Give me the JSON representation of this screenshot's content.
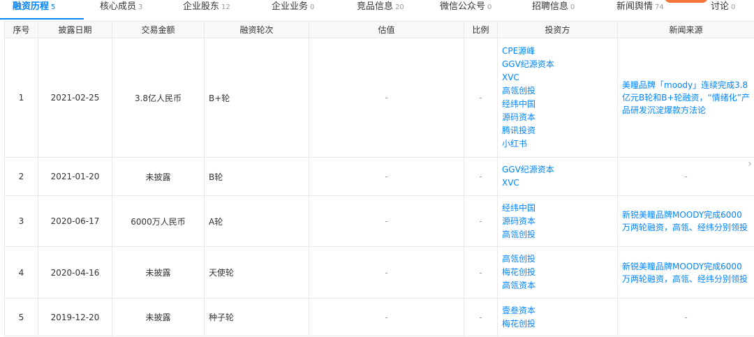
{
  "tabs": [
    {
      "label": "融资历程",
      "count": "5",
      "active": true
    },
    {
      "label": "核心成员",
      "count": "3"
    },
    {
      "label": "企业股东",
      "count": "12"
    },
    {
      "label": "企业业务",
      "count": "0"
    },
    {
      "label": "竞品信息",
      "count": "20"
    },
    {
      "label": "微信公众号",
      "count": "0"
    },
    {
      "label": "招聘信息",
      "count": "0"
    },
    {
      "label": "新闻舆情",
      "count": "74"
    },
    {
      "label": "讨论",
      "count": "0"
    }
  ],
  "table": {
    "headers": [
      "序号",
      "披露日期",
      "交易金额",
      "融资轮次",
      "估值",
      "比例",
      "投资方",
      "新闻来源"
    ],
    "rows": [
      {
        "index": "1",
        "date": "2021-02-25",
        "amount": "3.8亿人民币",
        "round": "B+轮",
        "valuation": "-",
        "ratio": "-",
        "investors": [
          "CPE源峰",
          "GGV纪源资本",
          "XVC",
          "高瓴创投",
          "经纬中国",
          "源码资本",
          "腾讯投资",
          "小红书"
        ],
        "news": "美瞳品牌「moody」连续完成3.8亿元B轮和B+轮融资，“情绪化”产品研发沉淀爆款方法论"
      },
      {
        "index": "2",
        "date": "2021-01-20",
        "amount": "未披露",
        "round": "B轮",
        "valuation": "-",
        "ratio": "-",
        "investors": [
          "GGV纪源资本",
          "XVC"
        ],
        "news": "-"
      },
      {
        "index": "3",
        "date": "2020-06-17",
        "amount": "6000万人民币",
        "round": "A轮",
        "valuation": "-",
        "ratio": "-",
        "investors": [
          "经纬中国",
          "源码资本",
          "高瓴创投"
        ],
        "news": "新锐美瞳品牌MOODY完成6000万两轮融资，高瓴、经纬分别领投"
      },
      {
        "index": "4",
        "date": "2020-04-16",
        "amount": "未披露",
        "round": "天使轮",
        "valuation": "-",
        "ratio": "-",
        "investors": [
          "高瓴创投",
          "梅花创投",
          "高瓴资本"
        ],
        "news": "新锐美瞳品牌MOODY完成6000万两轮融资，高瓴、经纬分别领投"
      },
      {
        "index": "5",
        "date": "2019-12-20",
        "amount": "未披露",
        "round": "种子轮",
        "valuation": "-",
        "ratio": "-",
        "investors": [
          "壹叁资本",
          "梅花创投"
        ],
        "news": "-"
      }
    ]
  },
  "colors": {
    "accent": "#0084ff",
    "header_bg": "#f7f8fa",
    "border": "#e9e9e9"
  },
  "icons": {
    "scroll_right": "chevron-right-icon"
  }
}
